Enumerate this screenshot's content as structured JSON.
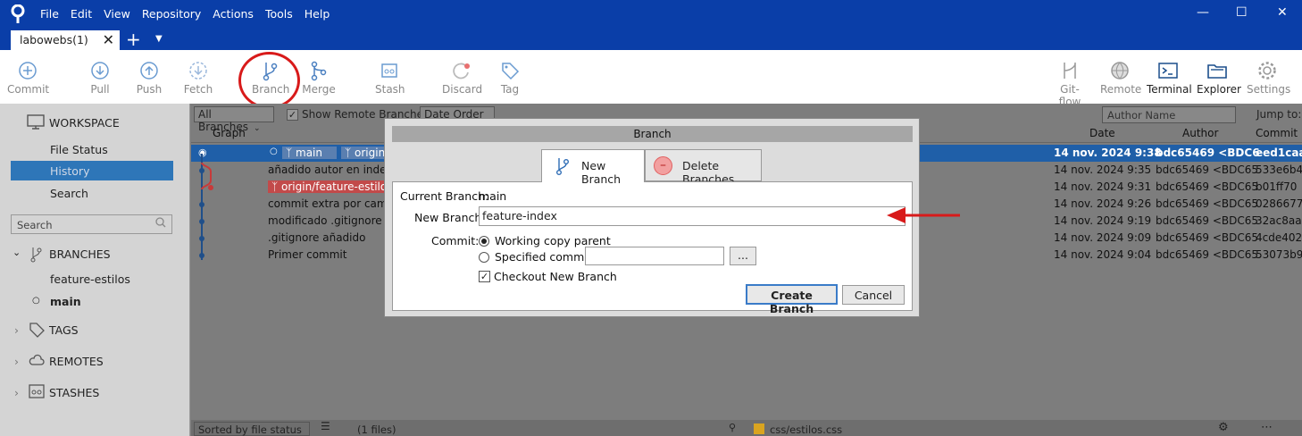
{
  "menu": [
    "File",
    "Edit",
    "View",
    "Repository",
    "Actions",
    "Tools",
    "Help"
  ],
  "tab": {
    "label": "labowebs(1)"
  },
  "toolbar": {
    "left": [
      "Commit",
      "Pull",
      "Push",
      "Fetch",
      "Branch",
      "Merge",
      "Stash",
      "Discard",
      "Tag"
    ],
    "right": [
      "Git-flow",
      "Remote",
      "Terminal",
      "Explorer",
      "Settings"
    ]
  },
  "sidebar": {
    "workspace": "WORKSPACE",
    "file_status": "File Status",
    "history": "History",
    "search_item": "Search",
    "search_placeholder": "Search",
    "branches": "BRANCHES",
    "branch_list": [
      "feature-estilos",
      "main"
    ],
    "tags": "TAGS",
    "remotes": "REMOTES",
    "stashes": "STASHES"
  },
  "filters": {
    "all_branches": "All Branches",
    "show_remote": "Show Remote Branches",
    "date_order": "Date Order",
    "author_placeholder": "Author Name",
    "jump_to": "Jump to:"
  },
  "columns": {
    "graph": "Graph",
    "date": "Date",
    "author": "Author",
    "commit": "Commit"
  },
  "commits": [
    {
      "desc": "",
      "date": "14 nov. 2024 9:38",
      "author": "bdc65469 <BDC6",
      "hash": "eed1caa",
      "tags": [
        "main",
        "origin"
      ]
    },
    {
      "desc": "añadido autor en index",
      "date": "14 nov. 2024 9:35",
      "author": "bdc65469 <BDC65",
      "hash": "533e6b4"
    },
    {
      "desc": "",
      "date": "14 nov. 2024 9:31",
      "author": "bdc65469 <BDC65",
      "hash": "b01ff70",
      "tags": [
        "origin/feature-estilos"
      ]
    },
    {
      "desc": "commit extra por cambio",
      "date": "14 nov. 2024 9:26",
      "author": "bdc65469 <BDC65",
      "hash": "0286677"
    },
    {
      "desc": "modificado .gitignore",
      "date": "14 nov. 2024 9:19",
      "author": "bdc65469 <BDC65",
      "hash": "32ac8aa"
    },
    {
      "desc": ".gitignore añadido",
      "date": "14 nov. 2024 9:09",
      "author": "bdc65469 <BDC65",
      "hash": "4cde402"
    },
    {
      "desc": "Primer commit",
      "date": "14 nov. 2024 9:04",
      "author": "bdc65469 <BDC65",
      "hash": "53073b9"
    }
  ],
  "dialog": {
    "title": "Branch",
    "tab_new": "New Branch",
    "tab_delete": "Delete Branches",
    "current_branch_label": "Current Branch:",
    "current_branch_value": "main",
    "new_branch_label": "New Branch:",
    "new_branch_value": "feature-index",
    "commit_label": "Commit:",
    "working_copy": "Working copy parent",
    "specified_commit": "Specified commit:",
    "browse": "...",
    "checkout": "Checkout New Branch",
    "create": "Create Branch",
    "cancel": "Cancel"
  },
  "bottom": {
    "sorted": "Sorted by file status",
    "files": "(1 files)",
    "file": "css/estilos.css"
  },
  "colors": {
    "accent": "#0a3ea8",
    "selection": "#1f5fa8",
    "annotation": "#d81a1a"
  }
}
